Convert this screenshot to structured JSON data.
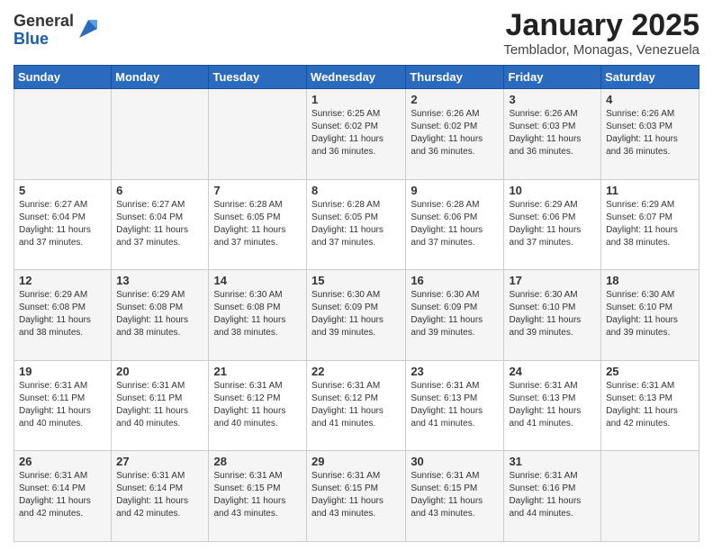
{
  "logo": {
    "general": "General",
    "blue": "Blue"
  },
  "header": {
    "title": "January 2025",
    "subtitle": "Temblador, Monagas, Venezuela"
  },
  "weekdays": [
    "Sunday",
    "Monday",
    "Tuesday",
    "Wednesday",
    "Thursday",
    "Friday",
    "Saturday"
  ],
  "weeks": [
    [
      {
        "day": "",
        "info": ""
      },
      {
        "day": "",
        "info": ""
      },
      {
        "day": "",
        "info": ""
      },
      {
        "day": "1",
        "info": "Sunrise: 6:25 AM\nSunset: 6:02 PM\nDaylight: 11 hours and 36 minutes."
      },
      {
        "day": "2",
        "info": "Sunrise: 6:26 AM\nSunset: 6:02 PM\nDaylight: 11 hours and 36 minutes."
      },
      {
        "day": "3",
        "info": "Sunrise: 6:26 AM\nSunset: 6:03 PM\nDaylight: 11 hours and 36 minutes."
      },
      {
        "day": "4",
        "info": "Sunrise: 6:26 AM\nSunset: 6:03 PM\nDaylight: 11 hours and 36 minutes."
      }
    ],
    [
      {
        "day": "5",
        "info": "Sunrise: 6:27 AM\nSunset: 6:04 PM\nDaylight: 11 hours and 37 minutes."
      },
      {
        "day": "6",
        "info": "Sunrise: 6:27 AM\nSunset: 6:04 PM\nDaylight: 11 hours and 37 minutes."
      },
      {
        "day": "7",
        "info": "Sunrise: 6:28 AM\nSunset: 6:05 PM\nDaylight: 11 hours and 37 minutes."
      },
      {
        "day": "8",
        "info": "Sunrise: 6:28 AM\nSunset: 6:05 PM\nDaylight: 11 hours and 37 minutes."
      },
      {
        "day": "9",
        "info": "Sunrise: 6:28 AM\nSunset: 6:06 PM\nDaylight: 11 hours and 37 minutes."
      },
      {
        "day": "10",
        "info": "Sunrise: 6:29 AM\nSunset: 6:06 PM\nDaylight: 11 hours and 37 minutes."
      },
      {
        "day": "11",
        "info": "Sunrise: 6:29 AM\nSunset: 6:07 PM\nDaylight: 11 hours and 38 minutes."
      }
    ],
    [
      {
        "day": "12",
        "info": "Sunrise: 6:29 AM\nSunset: 6:08 PM\nDaylight: 11 hours and 38 minutes."
      },
      {
        "day": "13",
        "info": "Sunrise: 6:29 AM\nSunset: 6:08 PM\nDaylight: 11 hours and 38 minutes."
      },
      {
        "day": "14",
        "info": "Sunrise: 6:30 AM\nSunset: 6:08 PM\nDaylight: 11 hours and 38 minutes."
      },
      {
        "day": "15",
        "info": "Sunrise: 6:30 AM\nSunset: 6:09 PM\nDaylight: 11 hours and 39 minutes."
      },
      {
        "day": "16",
        "info": "Sunrise: 6:30 AM\nSunset: 6:09 PM\nDaylight: 11 hours and 39 minutes."
      },
      {
        "day": "17",
        "info": "Sunrise: 6:30 AM\nSunset: 6:10 PM\nDaylight: 11 hours and 39 minutes."
      },
      {
        "day": "18",
        "info": "Sunrise: 6:30 AM\nSunset: 6:10 PM\nDaylight: 11 hours and 39 minutes."
      }
    ],
    [
      {
        "day": "19",
        "info": "Sunrise: 6:31 AM\nSunset: 6:11 PM\nDaylight: 11 hours and 40 minutes."
      },
      {
        "day": "20",
        "info": "Sunrise: 6:31 AM\nSunset: 6:11 PM\nDaylight: 11 hours and 40 minutes."
      },
      {
        "day": "21",
        "info": "Sunrise: 6:31 AM\nSunset: 6:12 PM\nDaylight: 11 hours and 40 minutes."
      },
      {
        "day": "22",
        "info": "Sunrise: 6:31 AM\nSunset: 6:12 PM\nDaylight: 11 hours and 41 minutes."
      },
      {
        "day": "23",
        "info": "Sunrise: 6:31 AM\nSunset: 6:13 PM\nDaylight: 11 hours and 41 minutes."
      },
      {
        "day": "24",
        "info": "Sunrise: 6:31 AM\nSunset: 6:13 PM\nDaylight: 11 hours and 41 minutes."
      },
      {
        "day": "25",
        "info": "Sunrise: 6:31 AM\nSunset: 6:13 PM\nDaylight: 11 hours and 42 minutes."
      }
    ],
    [
      {
        "day": "26",
        "info": "Sunrise: 6:31 AM\nSunset: 6:14 PM\nDaylight: 11 hours and 42 minutes."
      },
      {
        "day": "27",
        "info": "Sunrise: 6:31 AM\nSunset: 6:14 PM\nDaylight: 11 hours and 42 minutes."
      },
      {
        "day": "28",
        "info": "Sunrise: 6:31 AM\nSunset: 6:15 PM\nDaylight: 11 hours and 43 minutes."
      },
      {
        "day": "29",
        "info": "Sunrise: 6:31 AM\nSunset: 6:15 PM\nDaylight: 11 hours and 43 minutes."
      },
      {
        "day": "30",
        "info": "Sunrise: 6:31 AM\nSunset: 6:15 PM\nDaylight: 11 hours and 43 minutes."
      },
      {
        "day": "31",
        "info": "Sunrise: 6:31 AM\nSunset: 6:16 PM\nDaylight: 11 hours and 44 minutes."
      },
      {
        "day": "",
        "info": ""
      }
    ]
  ]
}
